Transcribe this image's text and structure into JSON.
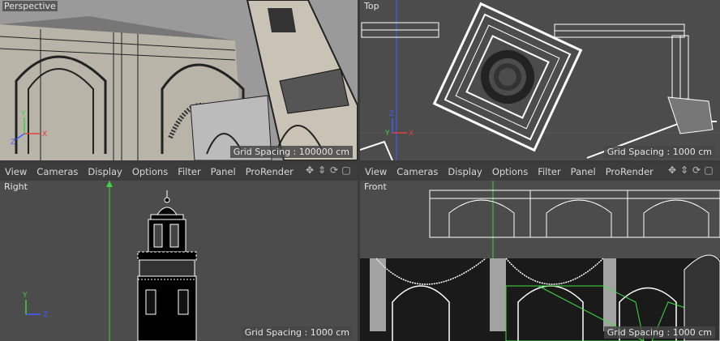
{
  "viewports": {
    "perspective": {
      "label": "Perspective",
      "grid_spacing": "Grid Spacing : 100000 cm"
    },
    "top": {
      "label": "Top",
      "grid_spacing": "Grid Spacing : 1000 cm"
    },
    "right": {
      "label": "Right",
      "grid_spacing": "Grid Spacing : 1000 cm"
    },
    "front": {
      "label": "Front",
      "grid_spacing": "Grid Spacing : 1000 cm"
    }
  },
  "menus": {
    "left": [
      "View",
      "Cameras",
      "Display",
      "Options",
      "Filter",
      "Panel",
      "ProRender"
    ],
    "right": [
      "View",
      "Cameras",
      "Display",
      "Options",
      "Filter",
      "Panel",
      "ProRender"
    ]
  },
  "icons": [
    "move-view-icon",
    "dolly-view-icon",
    "rotate-view-icon",
    "maximize-view-icon"
  ],
  "axes": {
    "x": "X",
    "y": "Y",
    "z": "Z"
  },
  "colors": {
    "viewport_bg": "#4c4c4c",
    "wire": "#ffffff",
    "axis_x": "#e04040",
    "axis_y": "#40d040",
    "axis_z": "#4060ff"
  }
}
